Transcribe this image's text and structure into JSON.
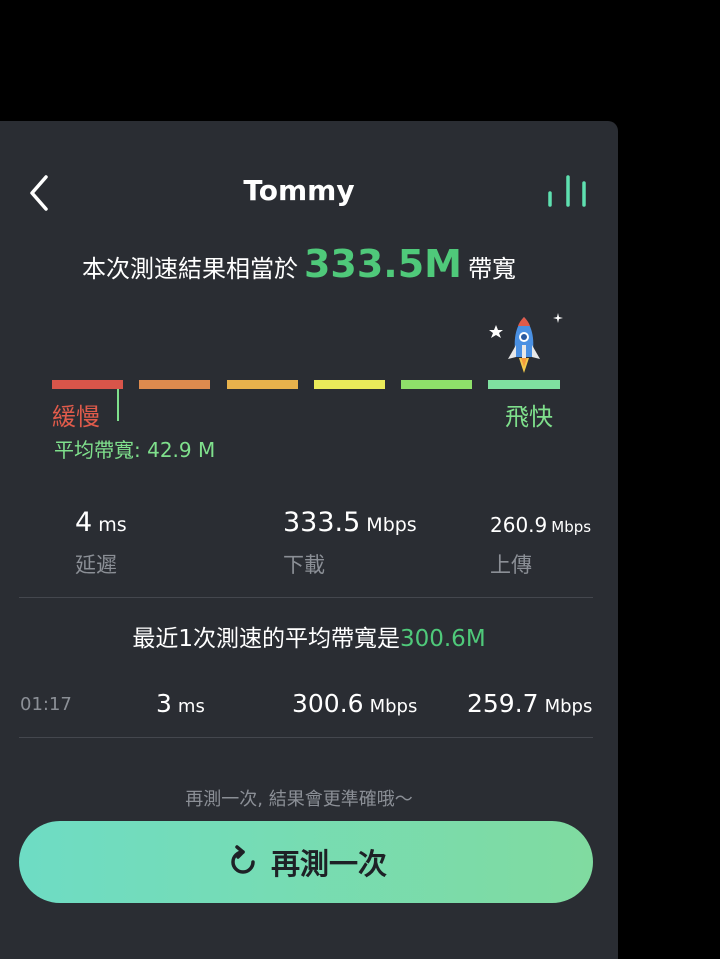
{
  "header": {
    "title": "Tommy",
    "back_icon": "chevron-left-icon",
    "history_icon": "bar-chart-icon"
  },
  "result": {
    "prefix": "本次測速結果相當於",
    "bandwidth": "333.5M",
    "suffix": "帶寬"
  },
  "meter": {
    "slow_label": "緩慢",
    "fast_label": "飛快",
    "average_label": "平均帶寬: 42.9 M",
    "segment_colors": [
      "#d8554a",
      "#de8b4e",
      "#e8b24c",
      "#eaeb5a",
      "#8ee06a",
      "#7fe0a0"
    ]
  },
  "stats": {
    "latency": {
      "value": "4",
      "unit": "ms",
      "label": "延遲"
    },
    "download": {
      "value": "333.5",
      "unit": "Mbps",
      "label": "下載"
    },
    "upload": {
      "value": "260.9",
      "unit": "Mbps",
      "label": "上傳"
    }
  },
  "recent": {
    "prefix": "最近1次測速的平均帶寬是",
    "value": "300.6M",
    "rows": [
      {
        "time": "01:17",
        "latency": "3",
        "latency_unit": "ms",
        "download": "300.6",
        "download_unit": "Mbps",
        "upload": "259.7",
        "upload_unit": "Mbps"
      }
    ]
  },
  "footer": {
    "hint": "再測一次, 結果會更準確哦～",
    "retest_label": "再測一次",
    "retest_icon": "refresh-icon"
  },
  "colors": {
    "accent": "#4fc97a",
    "panel_bg": "#2a2d33",
    "button_gradient": [
      "#6edcc4",
      "#80dba0"
    ]
  }
}
